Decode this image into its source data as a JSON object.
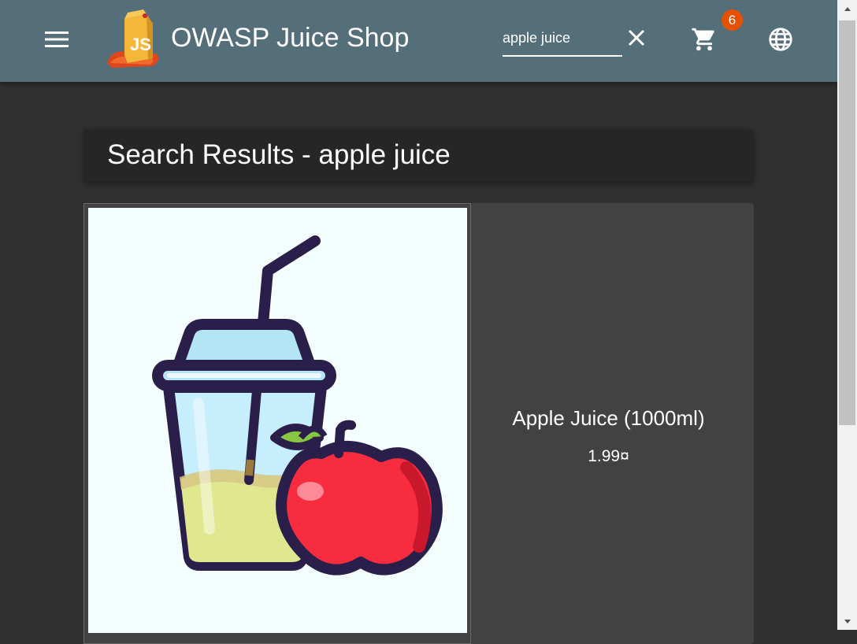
{
  "header": {
    "title": "OWASP Juice Shop",
    "menu_icon": "menu-icon",
    "logo_text": "JS",
    "search_value": "apple juice",
    "clear_icon": "close-icon",
    "cart_icon": "cart-icon",
    "cart_count": "6",
    "language_icon": "globe-icon"
  },
  "colors": {
    "toolbar": "#546e7a",
    "background": "#303030",
    "card": "#424242",
    "badge": "#e65100"
  },
  "results": {
    "heading": "Search Results - apple juice"
  },
  "products": [
    {
      "name": "Apple Juice (1000ml)",
      "price": "1.99¤",
      "image_icon": "apple-juice-icon"
    }
  ]
}
